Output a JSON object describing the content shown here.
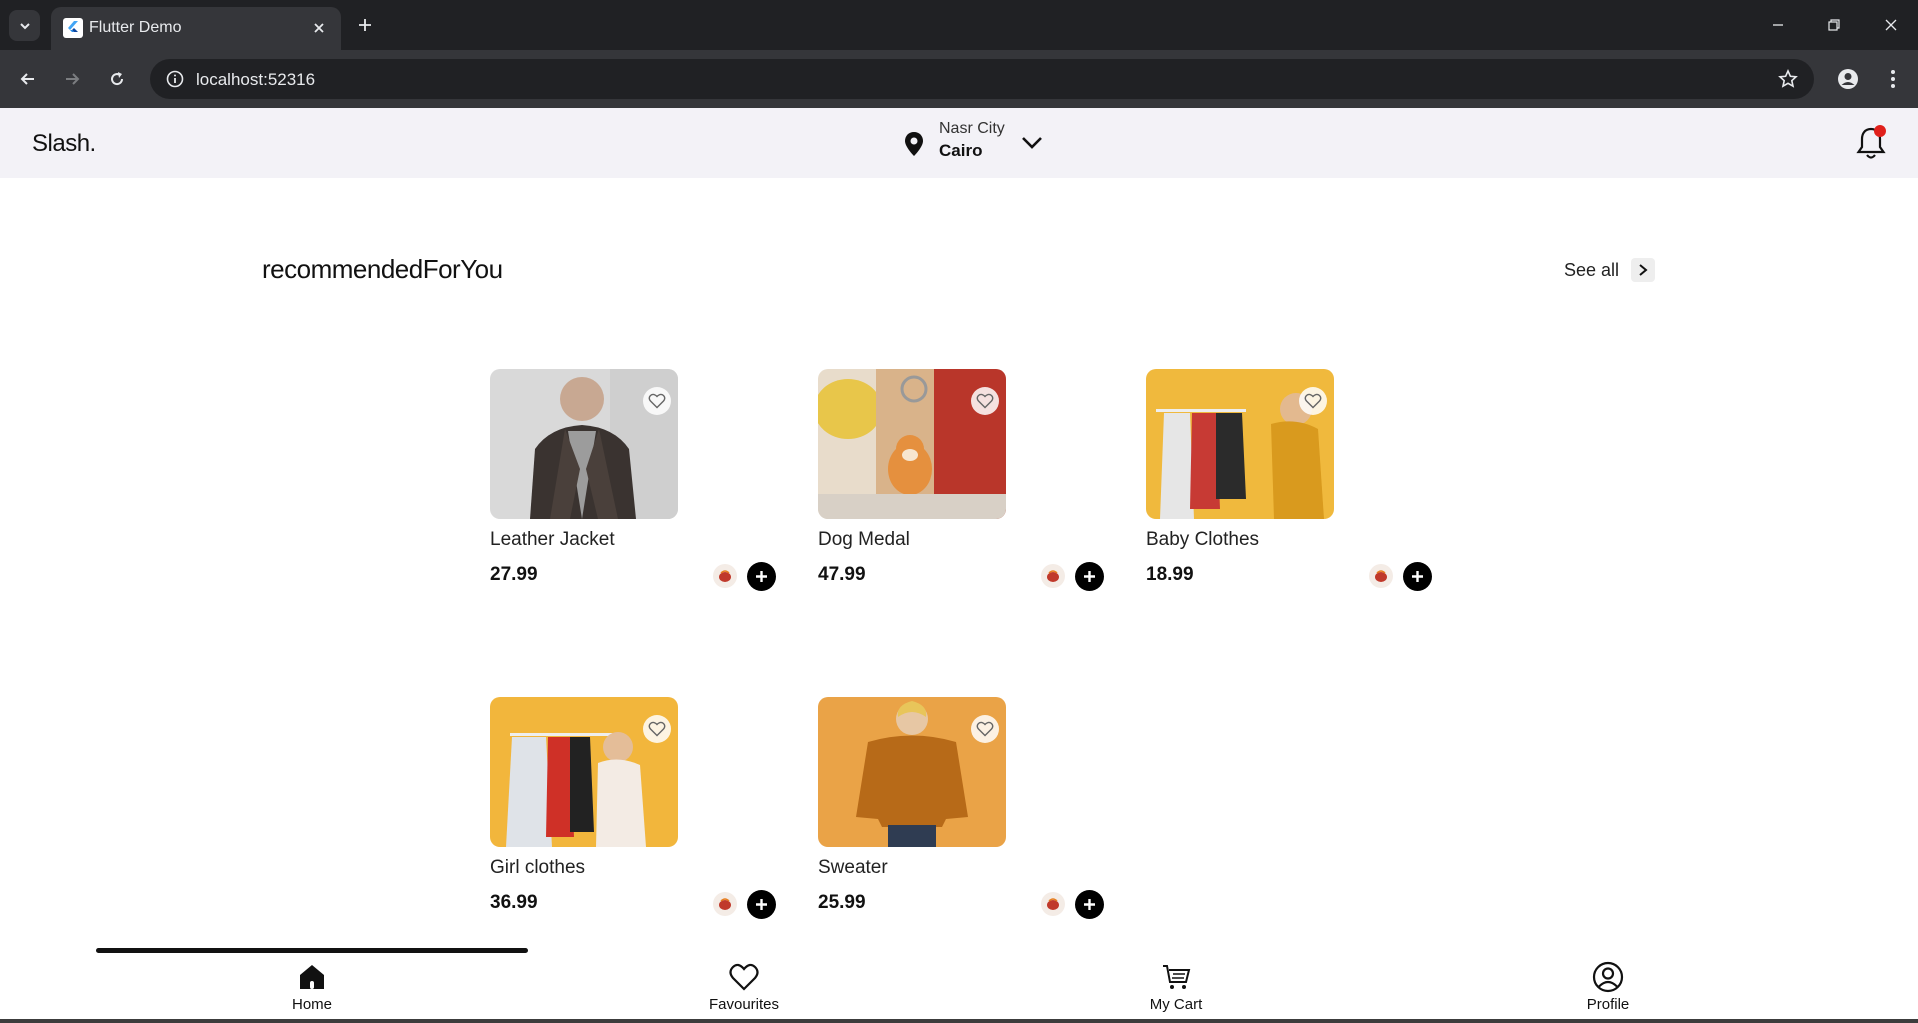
{
  "browser": {
    "tab_title": "Flutter Demo",
    "url": "localhost:52316"
  },
  "header": {
    "logo": "Slash.",
    "location_city": "Nasr City",
    "location_region": "Cairo"
  },
  "section": {
    "title": "recommendedForYou",
    "see_all": "See all"
  },
  "products": [
    {
      "name": "Leather Jacket",
      "price": "27.99"
    },
    {
      "name": "Dog Medal",
      "price": "47.99"
    },
    {
      "name": "Baby Clothes",
      "price": "18.99"
    },
    {
      "name": "Girl clothes",
      "price": "36.99"
    },
    {
      "name": "Sweater",
      "price": "25.99"
    }
  ],
  "bottom_nav": [
    {
      "label": "Home",
      "icon": "home-icon"
    },
    {
      "label": "Favourites",
      "icon": "heart-icon"
    },
    {
      "label": "My Cart",
      "icon": "cart-icon"
    },
    {
      "label": "Profile",
      "icon": "profile-icon"
    }
  ],
  "colors": {
    "notification_dot": "#e0201b",
    "header_bg": "#f3f2f7",
    "accent": "#000000"
  }
}
